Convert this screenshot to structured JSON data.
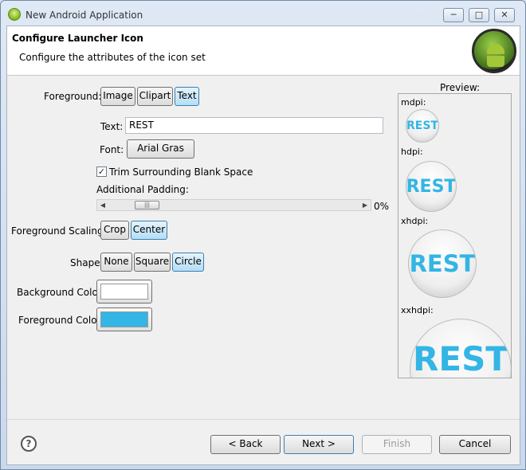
{
  "window": {
    "title": "New Android Application",
    "controls": {
      "minimize": "─",
      "maximize": "□",
      "close": "✕"
    }
  },
  "header": {
    "title": "Configure Launcher Icon",
    "description": "Configure the attributes of the icon set",
    "logo_icon": "android-logo-icon"
  },
  "foreground": {
    "label": "Foreground:",
    "options": [
      "Image",
      "Clipart",
      "Text"
    ],
    "selected": "Text"
  },
  "text_field": {
    "label": "Text:",
    "value": "REST"
  },
  "font": {
    "label": "Font:",
    "button": "Arial Gras"
  },
  "trim": {
    "label": "Trim Surrounding Blank Space",
    "checked": true,
    "check_glyph": "✓"
  },
  "padding": {
    "label": "Additional Padding:",
    "value_text": "0%",
    "value_percent": 0,
    "left_arrow": "◀",
    "right_arrow": "▶",
    "thumb_grip": "|||"
  },
  "scaling": {
    "label": "Foreground Scaling:",
    "options": [
      "Crop",
      "Center"
    ],
    "selected": "Center"
  },
  "shape": {
    "label": "Shape",
    "options": [
      "None",
      "Square",
      "Circle"
    ],
    "selected": "Circle"
  },
  "background_color": {
    "label": "Background Color:",
    "value": "#ffffff"
  },
  "foreground_color": {
    "label": "Foreground Color:",
    "value": "#33b5e5"
  },
  "preview": {
    "label": "Preview:",
    "icon_text": "REST",
    "densities": [
      "mdpi:",
      "hdpi:",
      "xhdpi:",
      "xxhdpi:"
    ]
  },
  "footer": {
    "help": "?",
    "back": "< Back",
    "next": "Next >",
    "finish": "Finish",
    "cancel": "Cancel"
  }
}
